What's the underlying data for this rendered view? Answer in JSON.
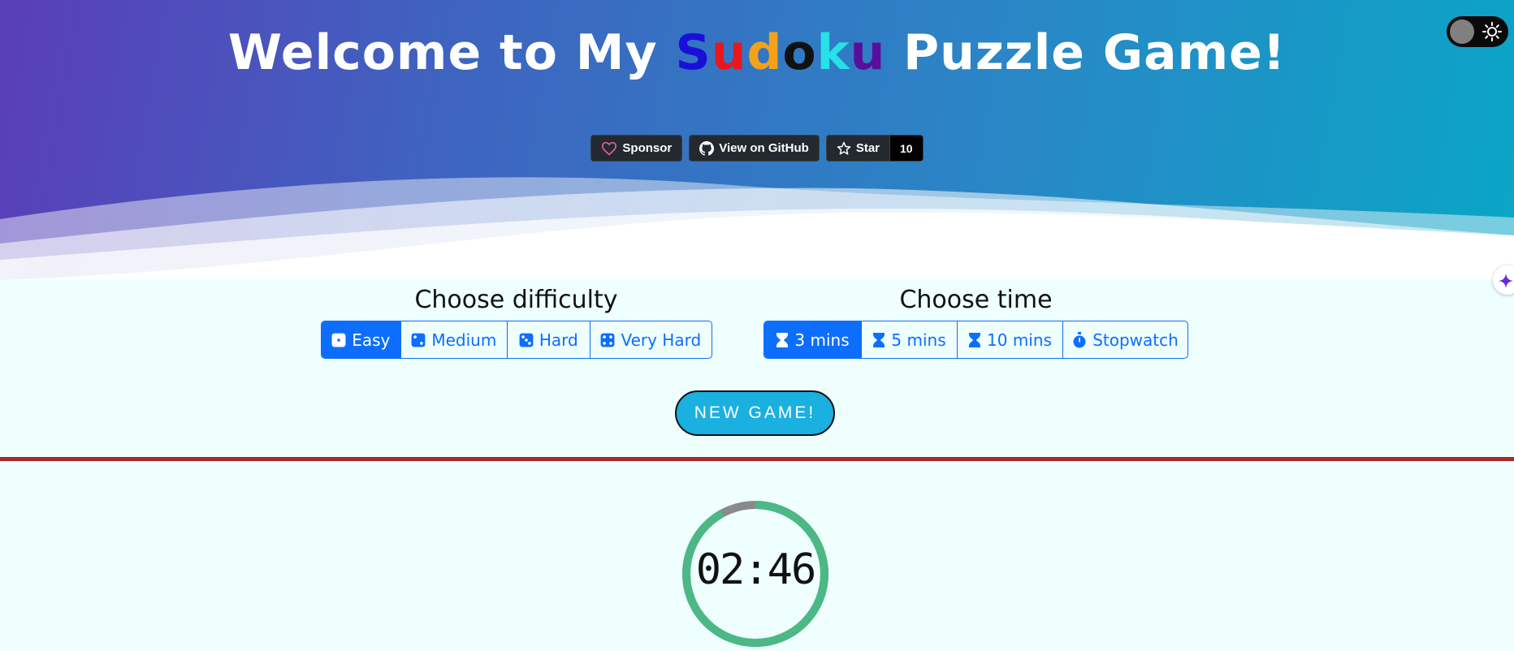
{
  "header": {
    "title_prefix": "Welcome to My ",
    "title_letters": [
      {
        "char": "S",
        "color": "#1a0fd8"
      },
      {
        "char": "u",
        "color": "#e8171d"
      },
      {
        "char": "d",
        "color": "#f3a21a"
      },
      {
        "char": "o",
        "color": "#111111"
      },
      {
        "char": "k",
        "color": "#27e0e8"
      },
      {
        "char": "u",
        "color": "#5a0f9c"
      }
    ],
    "title_suffix": " Puzzle Game!",
    "theme_toggle_icon": "sun-icon"
  },
  "github": {
    "sponsor_label": "Sponsor",
    "view_label": "View on GitHub",
    "star_label": "Star",
    "star_count": "10"
  },
  "difficulty": {
    "title": "Choose difficulty",
    "options": [
      {
        "label": "Easy",
        "icon": "dice-1-icon",
        "active": true
      },
      {
        "label": "Medium",
        "icon": "dice-2-icon",
        "active": false
      },
      {
        "label": "Hard",
        "icon": "dice-3-icon",
        "active": false
      },
      {
        "label": "Very Hard",
        "icon": "dice-4-icon",
        "active": false
      }
    ]
  },
  "time": {
    "title": "Choose time",
    "options": [
      {
        "label": "3 mins",
        "icon": "hourglass-icon",
        "active": true
      },
      {
        "label": "5 mins",
        "icon": "hourglass-icon",
        "active": false
      },
      {
        "label": "10 mins",
        "icon": "hourglass-icon",
        "active": false
      },
      {
        "label": "Stopwatch",
        "icon": "stopwatch-icon",
        "active": false
      }
    ]
  },
  "new_game_label": "NEW GAME!",
  "timer": {
    "display": "02:46",
    "remaining_fraction": 0.92,
    "ring_color": "#4bb886",
    "track_color": "#8a8a8a"
  },
  "colors": {
    "accent": "#0d6efd",
    "divider": "#a5282a",
    "new_game_bg": "#1ab0e0"
  }
}
